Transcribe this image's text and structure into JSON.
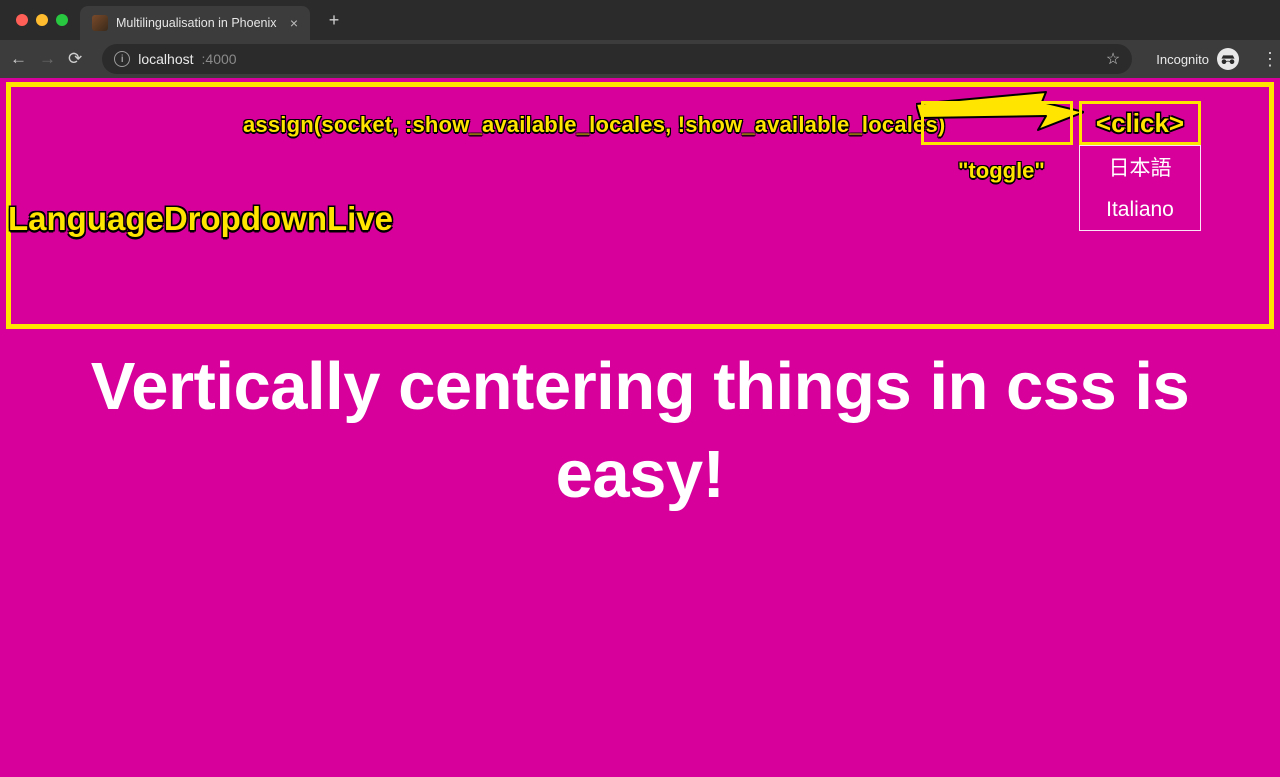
{
  "browser": {
    "tab_title": "Multilingualisation in Phoenix",
    "url_host": "localhost",
    "url_port": ":4000",
    "incognito_label": "Incognito"
  },
  "annotations": {
    "code": "assign(socket, :show_available_locales, !show_available_locales)",
    "toggle": "\"toggle\"",
    "live": "LanguageDropdownLive",
    "click": "<click>"
  },
  "dropdown": {
    "items": [
      "日本語",
      "Italiano"
    ]
  },
  "page": {
    "headline": "Vertically centering things in css is easy!"
  },
  "colors": {
    "accent_yellow": "#ffe500",
    "page_magenta": "#d7009b"
  }
}
